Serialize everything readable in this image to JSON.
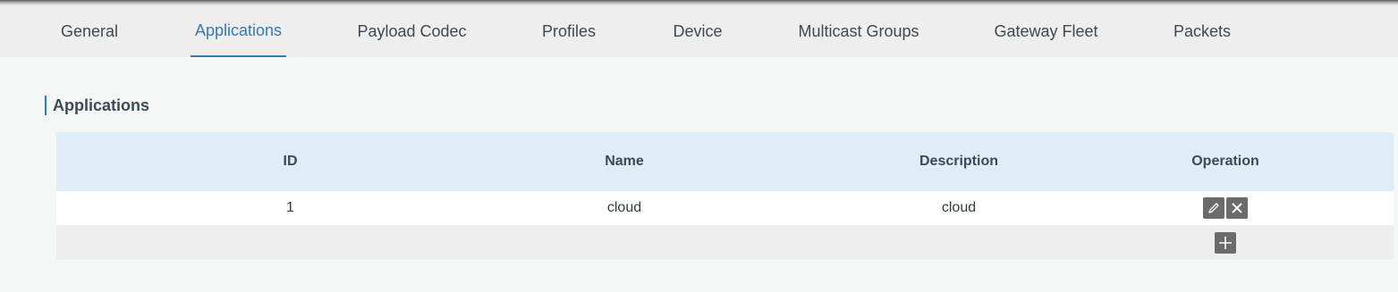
{
  "tabs": [
    {
      "label": "General",
      "active": false
    },
    {
      "label": "Applications",
      "active": true
    },
    {
      "label": "Payload Codec",
      "active": false
    },
    {
      "label": "Profiles",
      "active": false
    },
    {
      "label": "Device",
      "active": false
    },
    {
      "label": "Multicast Groups",
      "active": false
    },
    {
      "label": "Gateway Fleet",
      "active": false
    },
    {
      "label": "Packets",
      "active": false
    }
  ],
  "section": {
    "title": "Applications"
  },
  "table": {
    "headers": {
      "id": "ID",
      "name": "Name",
      "description": "Description",
      "operation": "Operation"
    },
    "rows": [
      {
        "id": "1",
        "name": "cloud",
        "description": "cloud"
      }
    ]
  },
  "icons": {
    "edit": "pencil-icon",
    "delete": "close-icon",
    "add": "plus-icon"
  },
  "colors": {
    "accent": "#2e7bc1",
    "header_bg": "#deedf7",
    "button_bg": "#6b6b6b"
  }
}
